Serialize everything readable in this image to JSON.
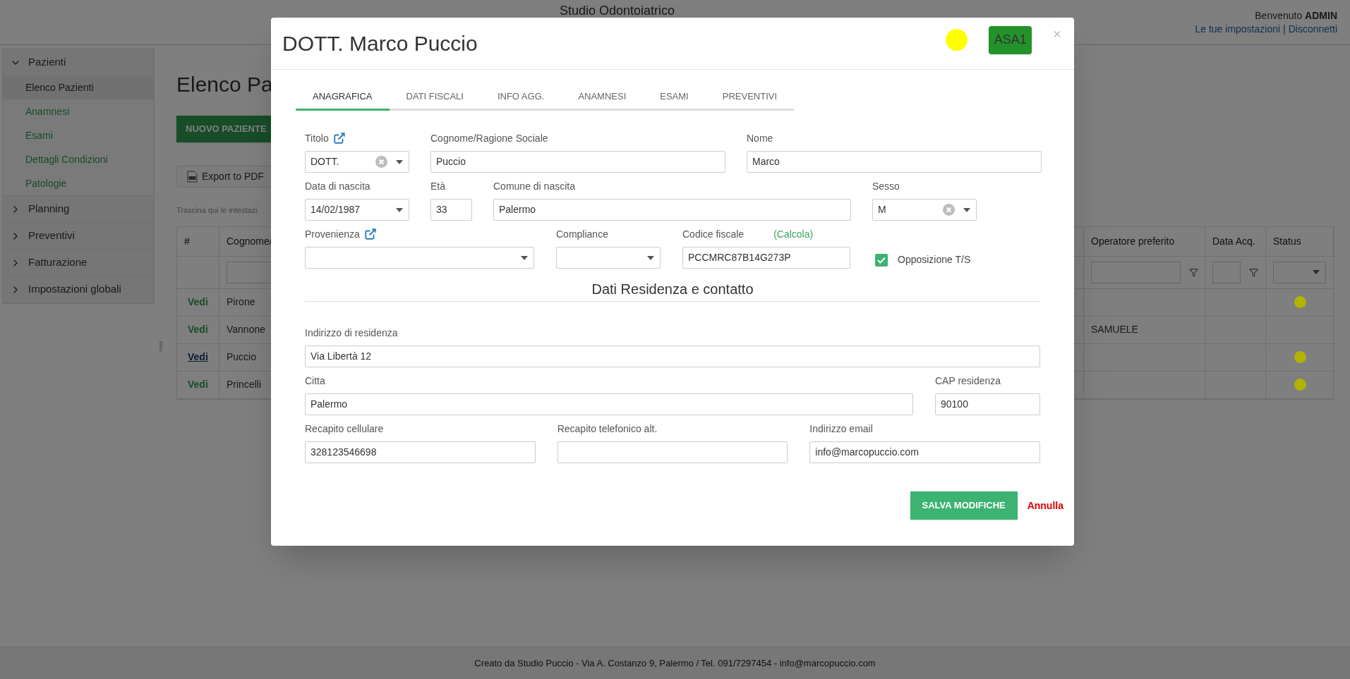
{
  "header": {
    "title": "Studio Odontoiatrico",
    "welcome": "Benvenuto",
    "user": "ADMIN",
    "links": [
      {
        "label": "Le tue impostazioni"
      },
      {
        "label": "Disconnetti"
      }
    ],
    "separator": "|"
  },
  "sidebar": {
    "sections": [
      {
        "label": "Pazienti",
        "expanded": true,
        "children": [
          {
            "label": "Elenco Pazienti",
            "selected": true
          },
          {
            "label": "Anamnesi",
            "selected": false
          },
          {
            "label": "Esami",
            "selected": false
          },
          {
            "label": "Dettagli Condizioni",
            "selected": false
          },
          {
            "label": "Patologie",
            "selected": false
          }
        ]
      },
      {
        "label": "Planning",
        "expanded": false
      },
      {
        "label": "Preventivi",
        "expanded": false
      },
      {
        "label": "Fatturazione",
        "expanded": false
      },
      {
        "label": "Impostazioni globali",
        "expanded": false
      }
    ]
  },
  "main": {
    "title": "Elenco Pa",
    "new_button": "NUOVO PAZIENTE",
    "export_button": "Export to PDF",
    "group_hint": "Trascina qui le intestazi",
    "table": {
      "columns": [
        "#",
        "Cognome/",
        "Operatore preferito",
        "Data Acq.",
        "Status"
      ],
      "rows": [
        {
          "link": "Vedi",
          "focused": false,
          "surname": "Pirone",
          "color": "#b3b300"
        },
        {
          "link": "Vedi",
          "focused": false,
          "surname": "Vannone",
          "operator": "SAMUELE"
        },
        {
          "link": "Vedi",
          "focused": true,
          "surname": "Puccio",
          "color": "#b3b300"
        },
        {
          "link": "Vedi",
          "focused": false,
          "surname": "Princelli",
          "color": "#b3b300"
        }
      ]
    }
  },
  "modal": {
    "title": "DOTT. Marco Puccio",
    "status_dot": {
      "color": "#ffff00"
    },
    "badge": "ASA1",
    "close": "×",
    "tabs": [
      {
        "label": "ANAGRAFICA",
        "selected": true
      },
      {
        "label": "DATI FISCALI",
        "selected": false
      },
      {
        "label": "INFO AGG.",
        "selected": false
      },
      {
        "label": "ANAMNESI",
        "selected": false
      },
      {
        "label": "ESAMI",
        "selected": false
      },
      {
        "label": "PREVENTIVI",
        "selected": false
      }
    ],
    "rows": [
      [
        {
          "kind": "select",
          "label": "Titolo",
          "link_icon": true,
          "value": "DOTT.",
          "clearable": true
        },
        {
          "kind": "text",
          "label": "Cognome/Ragione Sociale",
          "value": "Puccio"
        },
        {
          "kind": "text",
          "label": "Nome",
          "value": "Marco"
        }
      ],
      [
        {
          "kind": "select",
          "label": "Data di nascita",
          "value": "14/02/1987",
          "clearable": false
        },
        {
          "kind": "text",
          "label": "Età",
          "value": "33"
        },
        {
          "kind": "text",
          "label": "Comune di nascita",
          "value": "Palermo"
        },
        {
          "kind": "select",
          "label": "Sesso",
          "value": "M",
          "clearable": true
        }
      ],
      [
        {
          "kind": "select",
          "label": "Provenienza",
          "link_icon": true,
          "clearable": false
        },
        {
          "kind": "select",
          "label": "Compliance",
          "clearable": false
        },
        {
          "kind": "text",
          "label": "Codice fiscale",
          "action": "(Calcola)",
          "value": "PCCMRC87B14G273P"
        },
        {
          "kind": "checkbox",
          "label": "Opposizione T/S",
          "checked": true
        }
      ]
    ],
    "section_title": "Dati Residenza e contatto",
    "contact_rows": [
      [
        {
          "kind": "text",
          "label": "Indirizzo di residenza",
          "value": "Via Libertà 12"
        }
      ],
      [
        {
          "kind": "text",
          "label": "Citta",
          "value": "Palermo"
        },
        {
          "kind": "text",
          "label": "CAP residenza",
          "value": "90100"
        }
      ],
      [
        {
          "kind": "text",
          "label": "Recapito cellulare",
          "value": "328123546698"
        },
        {
          "kind": "text",
          "label": "Recapito telefonico alt."
        },
        {
          "kind": "text",
          "label": "Indirizzo email",
          "value": "info@marcopuccio.com"
        }
      ]
    ],
    "save_button": "SALVA MODIFICHE",
    "cancel": "Annulla"
  },
  "footer": {
    "text": "Creato da Studio Puccio - Via A. Costanzo 9, Palermo / Tel. 091/7297454 - info@marcopuccio.com"
  }
}
